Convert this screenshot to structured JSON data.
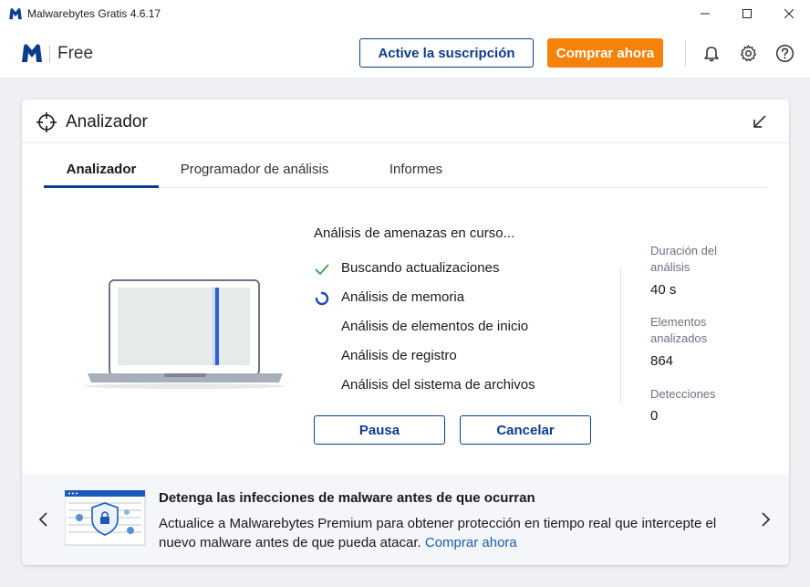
{
  "window": {
    "title": "Malwarebytes Gratis 4.6.17"
  },
  "header": {
    "edition": "Free",
    "activate_label": "Active la suscripción",
    "buy_label": "Comprar ahora",
    "icons": [
      "bell-icon",
      "gear-icon",
      "help-icon"
    ]
  },
  "colors": {
    "brand_blue": "#0d3c8c",
    "accent_orange": "#f5820b",
    "success_green": "#2ea44f",
    "link_blue": "#1a5fb4"
  },
  "card": {
    "title": "Analizador",
    "tabs": [
      {
        "label": "Analizador",
        "active": true
      },
      {
        "label": "Programador de análisis",
        "active": false
      },
      {
        "label": "Informes",
        "active": false
      }
    ],
    "scan_title": "Análisis de amenazas en curso...",
    "steps": [
      {
        "label": "Buscando actualizaciones",
        "status": "done"
      },
      {
        "label": "Análisis de memoria",
        "status": "in-progress"
      },
      {
        "label": "Análisis de elementos de inicio",
        "status": "pending"
      },
      {
        "label": "Análisis de registro",
        "status": "pending"
      },
      {
        "label": "Análisis del sistema de archivos",
        "status": "pending"
      }
    ],
    "pause_label": "Pausa",
    "cancel_label": "Cancelar",
    "stats": {
      "duration_label": "Duración del análisis",
      "duration_value": "40 s",
      "items_label": "Elementos analizados",
      "items_value": "864",
      "detections_label": "Detecciones",
      "detections_value": "0"
    }
  },
  "banner": {
    "title": "Detenga las infecciones de malware antes de que ocurran",
    "text": "Actualice a Malwarebytes Premium para obtener protección en tiempo real que intercepte el nuevo malware antes de que pueda atacar.",
    "link": "Comprar ahora"
  }
}
